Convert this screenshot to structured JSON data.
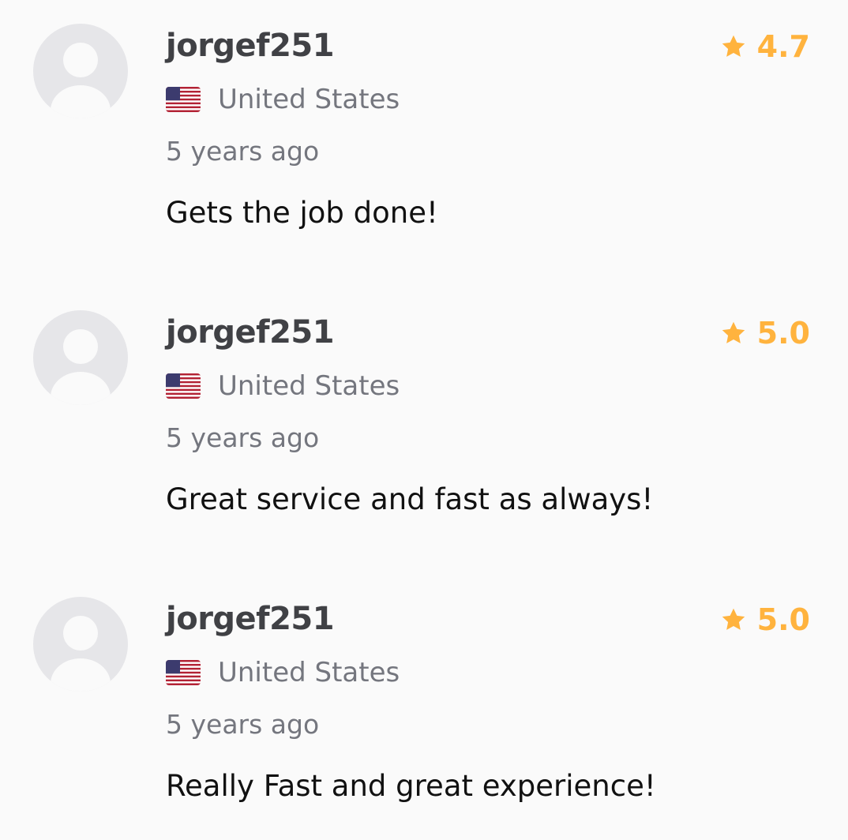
{
  "colors": {
    "background": "#fafafa",
    "username": "#404145",
    "meta_text": "#74767e",
    "comment_text": "#111111",
    "star": "#ffb33e",
    "avatar_bg": "#e6e6e9"
  },
  "icons": {
    "avatar": "user-avatar-placeholder-icon",
    "flag": "us-flag-icon",
    "rating": "star-icon"
  },
  "reviews": [
    {
      "username": "jorgef251",
      "country": "United States",
      "time": "5 years ago",
      "comment": "Gets the job done!",
      "rating": "4.7"
    },
    {
      "username": "jorgef251",
      "country": "United States",
      "time": "5 years ago",
      "comment": "Great service and fast as always!",
      "rating": "5.0"
    },
    {
      "username": "jorgef251",
      "country": "United States",
      "time": "5 years ago",
      "comment": "Really Fast and great experience!",
      "rating": "5.0"
    }
  ]
}
